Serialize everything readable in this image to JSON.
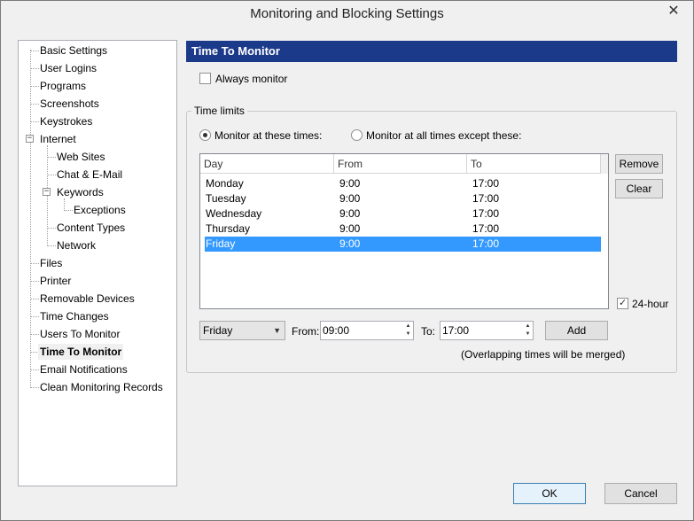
{
  "window": {
    "title": "Monitoring and Blocking Settings"
  },
  "tree": {
    "items": [
      {
        "label": "Basic Settings"
      },
      {
        "label": "User Logins"
      },
      {
        "label": "Programs"
      },
      {
        "label": "Screenshots"
      },
      {
        "label": "Keystrokes"
      },
      {
        "label": "Internet"
      },
      {
        "label": "Web Sites"
      },
      {
        "label": "Chat & E-Mail"
      },
      {
        "label": "Keywords"
      },
      {
        "label": "Exceptions"
      },
      {
        "label": "Content Types"
      },
      {
        "label": "Network"
      },
      {
        "label": "Files"
      },
      {
        "label": "Printer"
      },
      {
        "label": "Removable Devices"
      },
      {
        "label": "Time Changes"
      },
      {
        "label": "Users To Monitor"
      },
      {
        "label": "Time To Monitor"
      },
      {
        "label": "Email Notifications"
      },
      {
        "label": "Clean Monitoring Records"
      }
    ],
    "expander_symbol": "−"
  },
  "panel": {
    "header": "Time To Monitor",
    "always_monitor": {
      "label": "Always monitor",
      "checked": false
    },
    "time_limits": {
      "title": "Time limits",
      "radio_at_these": "Monitor at these times:",
      "radio_except": "Monitor at all times except these:",
      "columns": [
        "Day",
        "From",
        "To"
      ],
      "rows": [
        {
          "day": "Monday",
          "from": "9:00",
          "to": "17:00"
        },
        {
          "day": "Tuesday",
          "from": "9:00",
          "to": "17:00"
        },
        {
          "day": "Wednesday",
          "from": "9:00",
          "to": "17:00"
        },
        {
          "day": "Thursday",
          "from": "9:00",
          "to": "17:00"
        },
        {
          "day": "Friday",
          "from": "9:00",
          "to": "17:00"
        }
      ],
      "selected_row": "Friday",
      "remove_label": "Remove",
      "clear_label": "Clear",
      "hour24_label": "24-hour",
      "hour24_checked": true,
      "day_select": "Friday",
      "from_label": "From:",
      "from_value": "09:00",
      "to_label": "To:",
      "to_value": "17:00",
      "add_label": "Add",
      "note": "(Overlapping times will be merged)"
    }
  },
  "footer": {
    "ok_label": "OK",
    "cancel_label": "Cancel"
  },
  "colors": {
    "header_bg": "#1c3a8a",
    "selection": "#3399ff"
  },
  "icons": {
    "close": "close-icon",
    "dropdown": "chevron-down-icon",
    "spin": "spin-arrows-icon"
  }
}
